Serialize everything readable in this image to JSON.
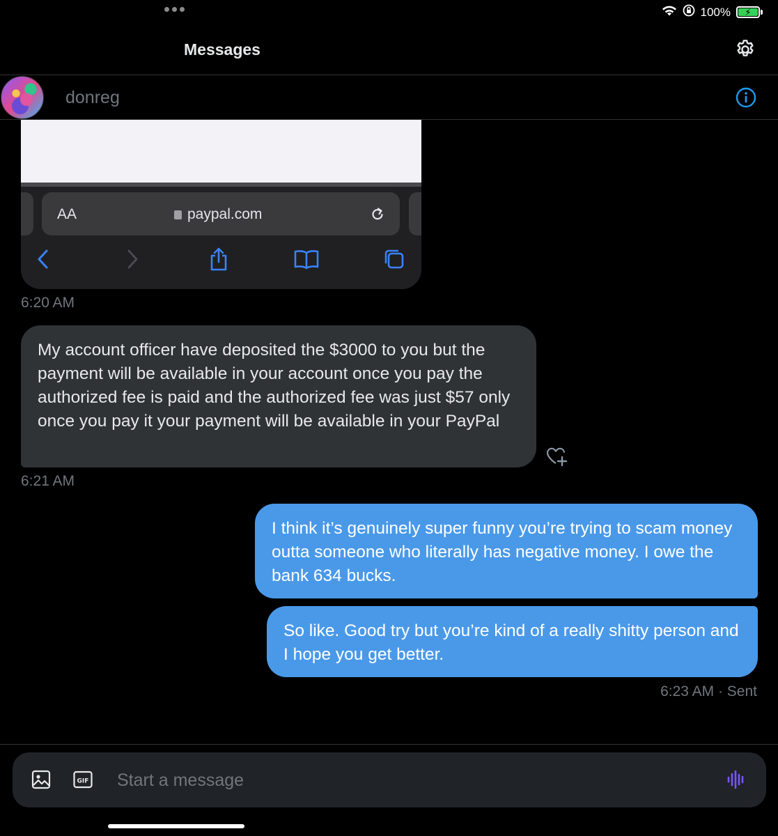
{
  "status_bar": {
    "battery_percent": "100%",
    "battery_level": 1.0
  },
  "header": {
    "title": "Messages"
  },
  "conversation": {
    "name": "donreg"
  },
  "shared_image": {
    "text_size_label": "AA",
    "url": "paypal.com"
  },
  "messages": [
    {
      "direction": "in",
      "type": "image",
      "timestamp": "6:20 AM"
    },
    {
      "direction": "in",
      "type": "text",
      "text": "My account officer have deposited the $3000 to you but the payment will be available in your account once you pay the authorized fee is paid and the authorized fee was just $57 only once you pay it your payment will be available in your PayPal",
      "timestamp": "6:21 AM"
    },
    {
      "direction": "out",
      "type": "text",
      "text": "I think it’s genuinely super funny you’re trying to scam money outta someone who literally has negative money. I owe the bank 634 bucks."
    },
    {
      "direction": "out",
      "type": "text",
      "text": "So like. Good try but you’re kind of a really shitty person and I hope you get better.",
      "timestamp": "6:23 AM",
      "status": "Sent"
    }
  ],
  "sent_meta": "6:23 AM · Sent",
  "composer": {
    "placeholder": "Start a message"
  },
  "colors": {
    "accent": "#1d9bf0",
    "outgoing_bubble": "#4a99e9",
    "incoming_bubble": "#2f3336",
    "voice_icon": "#7856ff",
    "battery": "#36d158"
  },
  "icons": [
    "wifi-icon",
    "orientation-lock-icon",
    "battery-icon",
    "gear-icon",
    "info-icon",
    "add-reaction-icon",
    "image-icon",
    "gif-icon",
    "voice-message-icon"
  ]
}
